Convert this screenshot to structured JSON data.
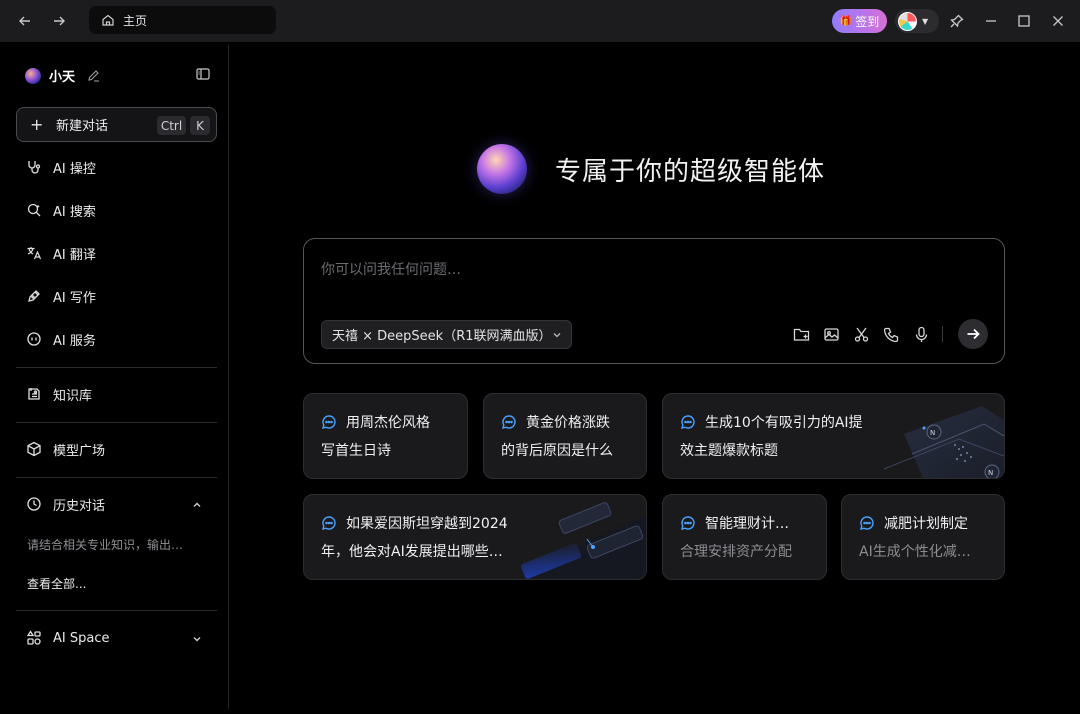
{
  "titlebar": {
    "tab_title": "主页",
    "signin_label": "签到",
    "icons": [
      "back-arrow-icon",
      "forward-arrow-icon",
      "home-icon",
      "gift-icon",
      "pin-icon",
      "minimize-icon",
      "maximize-icon",
      "close-icon"
    ]
  },
  "sidebar": {
    "username": "小天",
    "new_chat": {
      "label": "新建对话",
      "shortcut_ctrl": "Ctrl",
      "shortcut_key": "K"
    },
    "items": [
      {
        "label": "AI 操控",
        "icon": "stethoscope-icon"
      },
      {
        "label": "AI 搜索",
        "icon": "search-icon"
      },
      {
        "label": "AI 翻译",
        "icon": "translate-icon"
      },
      {
        "label": "AI 写作",
        "icon": "pen-icon"
      },
      {
        "label": "AI 服务",
        "icon": "service-icon"
      }
    ],
    "knowledge": "知识库",
    "models": "模型广场",
    "history": {
      "label": "历史对话",
      "entry": "请结合相关专业知识，输出…",
      "view_all": "查看全部..."
    },
    "space": "AI Space"
  },
  "main": {
    "hero_title": "专属于你的超级智能体",
    "input_placeholder": "你可以问我任何问题…",
    "model_selector": "天禧 × DeepSeek（R1联网满血版）",
    "tools": [
      "upload-folder-icon",
      "image-icon",
      "scissors-icon",
      "phone-icon",
      "microphone-icon"
    ],
    "suggestions": [
      {
        "line1": "用周杰伦风格",
        "line2": "写首生日诗"
      },
      {
        "line1": "黄金价格涨跌",
        "line2": "的背后原因是什么"
      },
      {
        "line1": "生成10个有吸引力的AI提",
        "line2": "效主题爆款标题"
      },
      {
        "line1": "如果爱因斯坦穿越到2024",
        "line2": "年，他会对AI发展提出哪些…"
      },
      {
        "line1": "智能理财计…",
        "line2": "合理安排资产分配"
      },
      {
        "line1": "减肥计划制定",
        "line2": "AI生成个性化减…"
      }
    ]
  },
  "colors": {
    "accent_blue": "#4aa3ff",
    "signin_gradient_start": "#8f7bff",
    "signin_gradient_end": "#d86fd7",
    "background": "#000000"
  }
}
